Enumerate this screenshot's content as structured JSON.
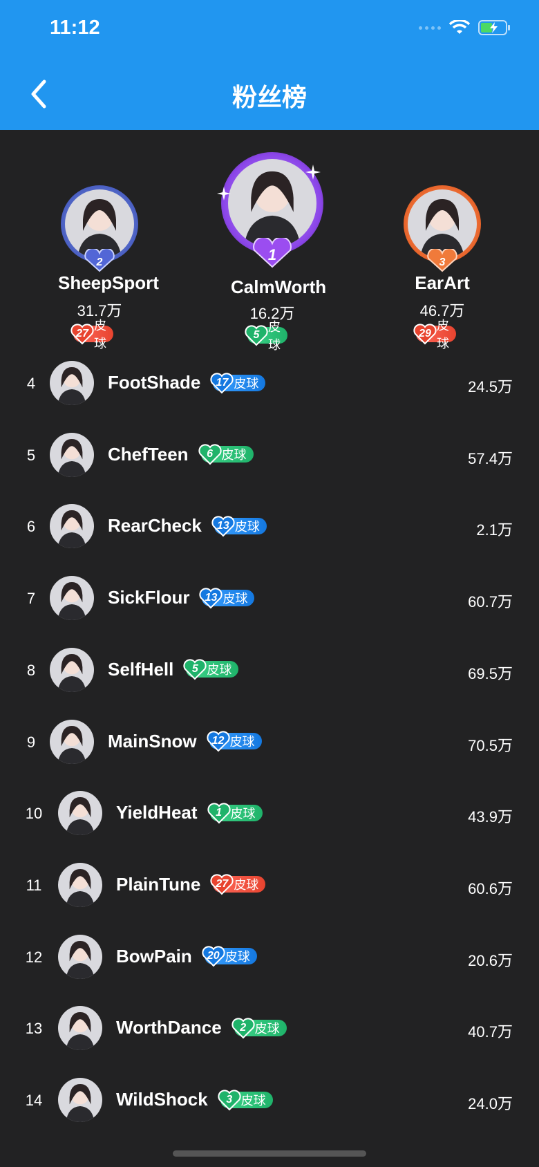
{
  "status": {
    "time": "11:12"
  },
  "nav": {
    "title": "粉丝榜"
  },
  "badge_label": "皮球",
  "podium": [
    {
      "rank": 2,
      "name": "SheepSport",
      "value": "31.7万",
      "level": "27",
      "badge_color": "red",
      "medal": "2"
    },
    {
      "rank": 1,
      "name": "CalmWorth",
      "value": "16.2万",
      "level": "5",
      "badge_color": "green",
      "medal": "1"
    },
    {
      "rank": 3,
      "name": "EarArt",
      "value": "46.7万",
      "level": "29",
      "badge_color": "red",
      "medal": "3"
    }
  ],
  "list": [
    {
      "rank": "4",
      "name": "FootShade",
      "level": "17",
      "badge_color": "blue",
      "value": "24.5万"
    },
    {
      "rank": "5",
      "name": "ChefTeen",
      "level": "6",
      "badge_color": "green",
      "value": "57.4万"
    },
    {
      "rank": "6",
      "name": "RearCheck",
      "level": "13",
      "badge_color": "blue",
      "value": "2.1万"
    },
    {
      "rank": "7",
      "name": "SickFlour",
      "level": "13",
      "badge_color": "blue",
      "value": "60.7万"
    },
    {
      "rank": "8",
      "name": "SelfHell",
      "level": "5",
      "badge_color": "green",
      "value": "69.5万"
    },
    {
      "rank": "9",
      "name": "MainSnow",
      "level": "12",
      "badge_color": "blue",
      "value": "70.5万"
    },
    {
      "rank": "10",
      "name": "YieldHeat",
      "level": "1",
      "badge_color": "green",
      "value": "43.9万"
    },
    {
      "rank": "11",
      "name": "PlainTune",
      "level": "27",
      "badge_color": "red",
      "value": "60.6万"
    },
    {
      "rank": "12",
      "name": "BowPain",
      "level": "20",
      "badge_color": "blue",
      "value": "20.6万"
    },
    {
      "rank": "13",
      "name": "WorthDance",
      "level": "2",
      "badge_color": "green",
      "value": "40.7万"
    },
    {
      "rank": "14",
      "name": "WildShock",
      "level": "3",
      "badge_color": "green",
      "value": "24.0万"
    }
  ],
  "colors": {
    "header": "#2196f0",
    "background": "#222223",
    "red": "#e8442f",
    "green": "#1fb36a",
    "blue": "#1478e0"
  }
}
